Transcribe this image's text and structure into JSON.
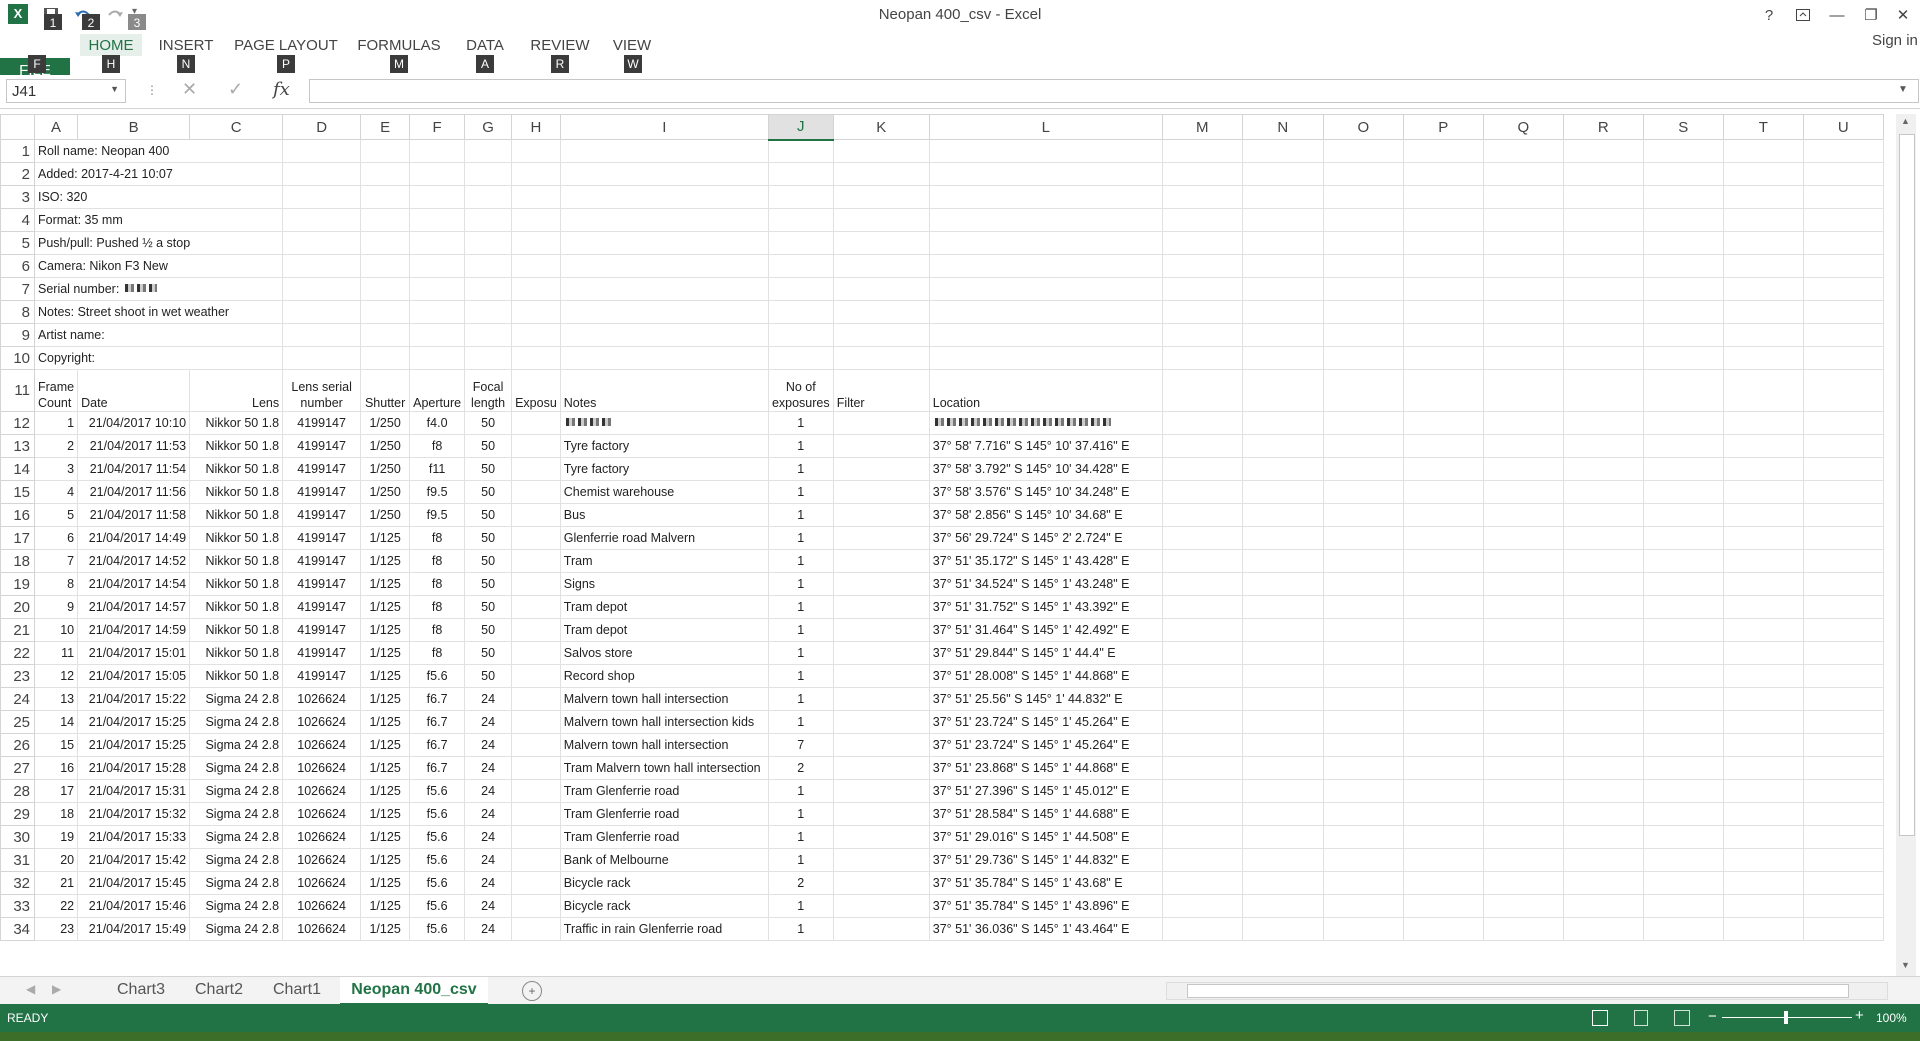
{
  "window": {
    "title": "Neopan 400_csv - Excel",
    "sign_in": "Sign in",
    "help": "?"
  },
  "qat": {
    "keytips": [
      "1",
      "2",
      "3"
    ]
  },
  "ribbon": {
    "tabs": [
      {
        "label": "FILE",
        "key": "F"
      },
      {
        "label": "HOME",
        "key": "H"
      },
      {
        "label": "INSERT",
        "key": "N"
      },
      {
        "label": "PAGE LAYOUT",
        "key": "P"
      },
      {
        "label": "FORMULAS",
        "key": "M"
      },
      {
        "label": "DATA",
        "key": "A"
      },
      {
        "label": "REVIEW",
        "key": "R"
      },
      {
        "label": "VIEW",
        "key": "W"
      }
    ]
  },
  "formula_bar": {
    "name_box": "J41",
    "fx": "fx",
    "formula": ""
  },
  "columns": [
    "A",
    "B",
    "C",
    "D",
    "E",
    "F",
    "G",
    "H",
    "I",
    "J",
    "K",
    "L",
    "M",
    "N",
    "O",
    "P",
    "Q",
    "R",
    "S",
    "T",
    "U"
  ],
  "meta_rows": [
    "Roll name: Neopan 400",
    "Added: 2017-4-21 10:07",
    "ISO: 320",
    "Format: 35 mm",
    "Push/pull: Pushed ½ a stop",
    "Camera: Nikon F3 New",
    "Serial number:",
    "Notes: Street shoot in wet weather",
    "Artist name:",
    "Copyright:"
  ],
  "headers": {
    "frame": [
      "Frame",
      "Count"
    ],
    "date": "Date",
    "lens": "Lens",
    "lens_serial": [
      "Lens serial",
      "number"
    ],
    "shutter": "Shutter",
    "aperture": "Aperture",
    "focal": [
      "Focal",
      "length"
    ],
    "exposure": "Exposu",
    "notes": "Notes",
    "exposures": [
      "No of",
      "exposures"
    ],
    "filter": "Filter",
    "location": "Location"
  },
  "rows": [
    [
      "1",
      "21/04/2017 10:10",
      "Nikkor 50 1.8",
      "4199147",
      "1/250",
      "f4.0",
      "50",
      "",
      "1",
      ""
    ],
    [
      "2",
      "21/04/2017 11:53",
      "Nikkor 50 1.8",
      "4199147",
      "1/250",
      "f8",
      "50",
      "Tyre factory",
      "1",
      "37° 58' 7.716\" S 145° 10' 37.416\" E"
    ],
    [
      "3",
      "21/04/2017 11:54",
      "Nikkor 50 1.8",
      "4199147",
      "1/250",
      "f11",
      "50",
      "Tyre factory",
      "1",
      "37° 58' 3.792\" S 145° 10' 34.428\" E"
    ],
    [
      "4",
      "21/04/2017 11:56",
      "Nikkor 50 1.8",
      "4199147",
      "1/250",
      "f9.5",
      "50",
      "Chemist warehouse",
      "1",
      "37° 58' 3.576\" S 145° 10' 34.248\" E"
    ],
    [
      "5",
      "21/04/2017 11:58",
      "Nikkor 50 1.8",
      "4199147",
      "1/250",
      "f9.5",
      "50",
      "Bus",
      "1",
      "37° 58' 2.856\" S 145° 10' 34.68\" E"
    ],
    [
      "6",
      "21/04/2017 14:49",
      "Nikkor 50 1.8",
      "4199147",
      "1/125",
      "f8",
      "50",
      "Glenferrie road Malvern",
      "1",
      "37° 56' 29.724\" S 145° 2' 2.724\" E"
    ],
    [
      "7",
      "21/04/2017 14:52",
      "Nikkor 50 1.8",
      "4199147",
      "1/125",
      "f8",
      "50",
      "Tram",
      "1",
      "37° 51' 35.172\" S 145° 1' 43.428\" E"
    ],
    [
      "8",
      "21/04/2017 14:54",
      "Nikkor 50 1.8",
      "4199147",
      "1/125",
      "f8",
      "50",
      "Signs",
      "1",
      "37° 51' 34.524\" S 145° 1' 43.248\" E"
    ],
    [
      "9",
      "21/04/2017 14:57",
      "Nikkor 50 1.8",
      "4199147",
      "1/125",
      "f8",
      "50",
      "Tram depot",
      "1",
      "37° 51' 31.752\" S 145° 1' 43.392\" E"
    ],
    [
      "10",
      "21/04/2017 14:59",
      "Nikkor 50 1.8",
      "4199147",
      "1/125",
      "f8",
      "50",
      "Tram depot",
      "1",
      "37° 51' 31.464\" S 145° 1' 42.492\" E"
    ],
    [
      "11",
      "21/04/2017 15:01",
      "Nikkor 50 1.8",
      "4199147",
      "1/125",
      "f8",
      "50",
      "Salvos store",
      "1",
      "37° 51' 29.844\" S 145° 1' 44.4\" E"
    ],
    [
      "12",
      "21/04/2017 15:05",
      "Nikkor 50 1.8",
      "4199147",
      "1/125",
      "f5.6",
      "50",
      "Record shop",
      "1",
      "37° 51' 28.008\" S 145° 1' 44.868\" E"
    ],
    [
      "13",
      "21/04/2017 15:22",
      "Sigma 24 2.8",
      "1026624",
      "1/125",
      "f6.7",
      "24",
      "Malvern town hall intersection",
      "1",
      "37° 51' 25.56\" S 145° 1' 44.832\" E"
    ],
    [
      "14",
      "21/04/2017 15:25",
      "Sigma 24 2.8",
      "1026624",
      "1/125",
      "f6.7",
      "24",
      "Malvern town hall intersection kids",
      "1",
      "37° 51' 23.724\" S 145° 1' 45.264\" E"
    ],
    [
      "15",
      "21/04/2017 15:25",
      "Sigma 24 2.8",
      "1026624",
      "1/125",
      "f6.7",
      "24",
      "Malvern town hall intersection",
      "7",
      "37° 51' 23.724\" S 145° 1' 45.264\" E"
    ],
    [
      "16",
      "21/04/2017 15:28",
      "Sigma 24 2.8",
      "1026624",
      "1/125",
      "f6.7",
      "24",
      "Tram Malvern town hall intersection",
      "2",
      "37° 51' 23.868\" S 145° 1' 44.868\" E"
    ],
    [
      "17",
      "21/04/2017 15:31",
      "Sigma 24 2.8",
      "1026624",
      "1/125",
      "f5.6",
      "24",
      "Tram Glenferrie road",
      "1",
      "37° 51' 27.396\" S 145° 1' 45.012\" E"
    ],
    [
      "18",
      "21/04/2017 15:32",
      "Sigma 24 2.8",
      "1026624",
      "1/125",
      "f5.6",
      "24",
      "Tram Glenferrie road",
      "1",
      "37° 51' 28.584\" S 145° 1' 44.688\" E"
    ],
    [
      "19",
      "21/04/2017 15:33",
      "Sigma 24 2.8",
      "1026624",
      "1/125",
      "f5.6",
      "24",
      "Tram Glenferrie road",
      "1",
      "37° 51' 29.016\" S 145° 1' 44.508\" E"
    ],
    [
      "20",
      "21/04/2017 15:42",
      "Sigma 24 2.8",
      "1026624",
      "1/125",
      "f5.6",
      "24",
      "Bank of Melbourne",
      "1",
      "37° 51' 29.736\" S 145° 1' 44.832\" E"
    ],
    [
      "21",
      "21/04/2017 15:45",
      "Sigma 24 2.8",
      "1026624",
      "1/125",
      "f5.6",
      "24",
      "Bicycle rack",
      "2",
      "37° 51' 35.784\" S 145° 1' 43.68\" E"
    ],
    [
      "22",
      "21/04/2017 15:46",
      "Sigma 24 2.8",
      "1026624",
      "1/125",
      "f5.6",
      "24",
      "Bicycle rack",
      "1",
      "37° 51' 35.784\" S 145° 1' 43.896\" E"
    ],
    [
      "23",
      "21/04/2017 15:49",
      "Sigma 24 2.8",
      "1026624",
      "1/125",
      "f5.6",
      "24",
      "Traffic in rain Glenferrie road",
      "1",
      "37° 51' 36.036\" S 145° 1' 43.464\" E"
    ]
  ],
  "sheet_tabs": [
    "Chart3",
    "Chart2",
    "Chart1",
    "Neopan 400_csv"
  ],
  "status": {
    "ready": "READY",
    "zoom": "100%"
  },
  "colors": {
    "accent": "#217346"
  }
}
